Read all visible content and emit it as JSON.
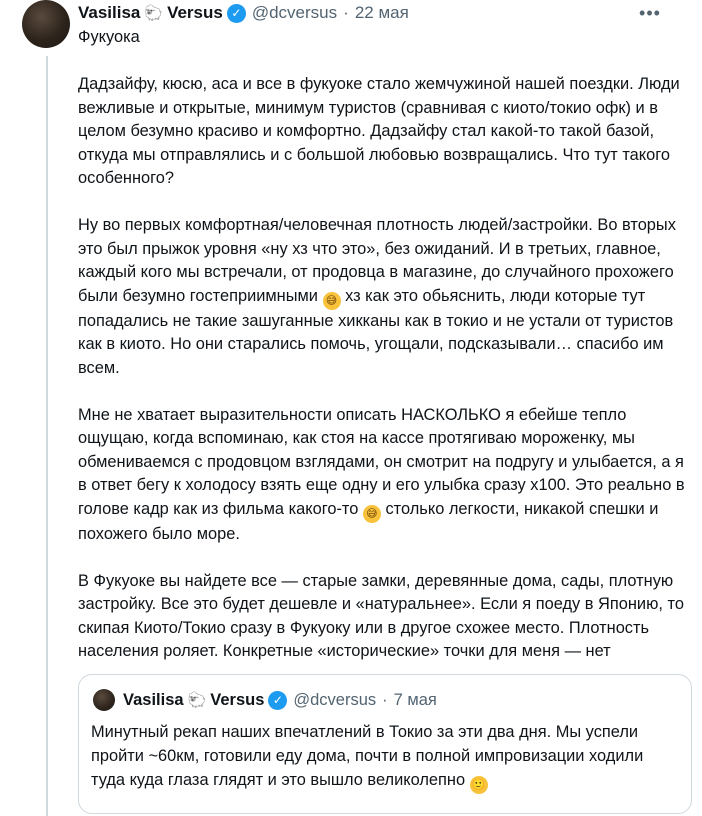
{
  "tweet": {
    "author_name": "Vasilisa",
    "author_emoji": "🐑",
    "author_suffix": "Versus",
    "verified_mark": "✓",
    "handle": "@dcversus",
    "separator": "·",
    "date": "22 мая",
    "more_icon": "•••",
    "title": "Фукуока",
    "paragraphs": [
      "Дадзайфу, кюсю, аса и все в фукуоке стало жемчужиной нашей поездки. Люди вежливые и открытые, минимум туристов (сравнивая с киото/токио офк) и в целом безумно красиво и комфортно. Дадзайфу стал какой-то такой базой, откуда мы отправлялись и с большой любовью возвращались. Что тут такого особенного?",
      "Ну во первых комфортная/человечная плотность людей/застройки. Во вторых это был прыжок уровня «ну хз что это», без ожиданий. И в третьих, главное, каждый кого мы встречали, от продовца в магазине, до случайного прохожего были безумно гостеприимными",
      "хз как это обьяснить, люди которые тут попадались не такие зашуганные хикканы как в токио и не устали от туристов как в киото. Но они старались помочь, угощали, подсказывали… спасибо им всем.",
      "Мне не хватает выразительности описать НАСКОЛЬКО я ебейше тепло ощущаю, когда вспоминаю, как стоя на кассе протягиваю мороженку, мы обмениваемся с продовцом взглядами, он смотрит на подругу и улыбается, а я в ответ бегу к холодосу взять еще одну и его улыбка сразу х100. Это реально в голове кадр как из фильма какого-то",
      "столько легкости, никакой спешки и похожего было море.",
      "В Фукуоке вы найдете все — старые замки, деревянные дома, сады, плотную застройку. Все это будет дешевле и «натуральнее». Если я поеду в Японию, то скипая Киото/Токио сразу в Фукуоку или в другое схожее место. Плотность населения роляет. Конкретные «исторические» точки для меня — нет"
    ],
    "emoji_sweat": "😅"
  },
  "quoted": {
    "author_name": "Vasilisa",
    "author_emoji": "🐑",
    "author_suffix": "Versus",
    "verified_mark": "✓",
    "handle": "@dcversus",
    "separator": "·",
    "date": "7 мая",
    "text": "Минутный рекап наших впечатлений в Токио за эти два дня. Мы успели пройти ~60км, готовили еду дома, почти в полной импровизации ходили туда куда глаза глядят и это вышло великолепно",
    "emoji": "🙂"
  }
}
